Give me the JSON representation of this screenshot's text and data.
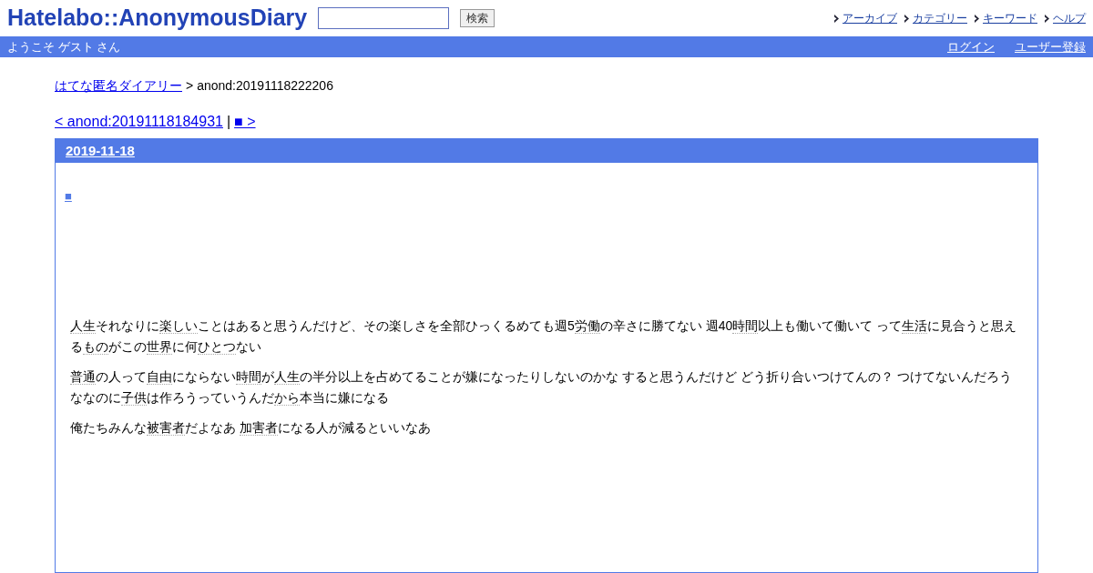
{
  "header": {
    "logo": "Hatelabo::AnonymousDiary",
    "search_button": "検索",
    "nav": [
      "アーカイブ",
      "カテゴリー",
      "キーワード",
      "ヘルプ"
    ]
  },
  "user_bar": {
    "welcome": "ようこそ ゲスト さん",
    "links": [
      "ログイン",
      "ユーザー登録"
    ]
  },
  "breadcrumb": {
    "home": "はてな匿名ダイアリー",
    "separator": ">",
    "current": "anond:20191118222206"
  },
  "pager": {
    "prev": "< anond:20191118184931",
    "separator": "|",
    "next": "■ >"
  },
  "day": {
    "date": "2019-11-18",
    "entry_mark": "■",
    "paragraphs": [
      [
        {
          "text": "人生",
          "keyword": true
        },
        {
          "text": "それなりに",
          "keyword": false
        },
        {
          "text": "楽しい",
          "keyword": true
        },
        {
          "text": "ことはあると思うんだけど、その楽しさを全部ひっくるめても週5",
          "keyword": false
        },
        {
          "text": "労働",
          "keyword": true
        },
        {
          "text": "の辛さに勝てない 週40",
          "keyword": false
        },
        {
          "text": "時間",
          "keyword": true
        },
        {
          "text": "以上も働いて働いて って",
          "keyword": false
        },
        {
          "text": "生活",
          "keyword": true
        },
        {
          "text": "に見合うと思える",
          "keyword": false
        },
        {
          "text": "もの",
          "keyword": true
        },
        {
          "text": "がこの",
          "keyword": false
        },
        {
          "text": "世界",
          "keyword": true
        },
        {
          "text": "に何",
          "keyword": false
        },
        {
          "text": "ひとつ",
          "keyword": true
        },
        {
          "text": "ない",
          "keyword": false
        }
      ],
      [
        {
          "text": "普通",
          "keyword": true
        },
        {
          "text": "の人って",
          "keyword": false
        },
        {
          "text": "自由",
          "keyword": true
        },
        {
          "text": "にならない",
          "keyword": false
        },
        {
          "text": "時間",
          "keyword": true
        },
        {
          "text": "が",
          "keyword": false
        },
        {
          "text": "人生",
          "keyword": true
        },
        {
          "text": "の半分以上を占めてることが嫌になったりしないのかな すると思うんだけど どう折り合いつけてんの？ つけてないんだろうななのに",
          "keyword": false
        },
        {
          "text": "子供",
          "keyword": true
        },
        {
          "text": "は作ろうっていうんだ",
          "keyword": false
        },
        {
          "text": "から",
          "keyword": true
        },
        {
          "text": "本当に嫌になる",
          "keyword": false
        }
      ],
      [
        {
          "text": "俺たちみんな",
          "keyword": false
        },
        {
          "text": "被害者",
          "keyword": true
        },
        {
          "text": "だよなあ ",
          "keyword": false
        },
        {
          "text": "加害者",
          "keyword": true
        },
        {
          "text": "になる人が減るといいなあ",
          "keyword": false
        }
      ]
    ]
  }
}
